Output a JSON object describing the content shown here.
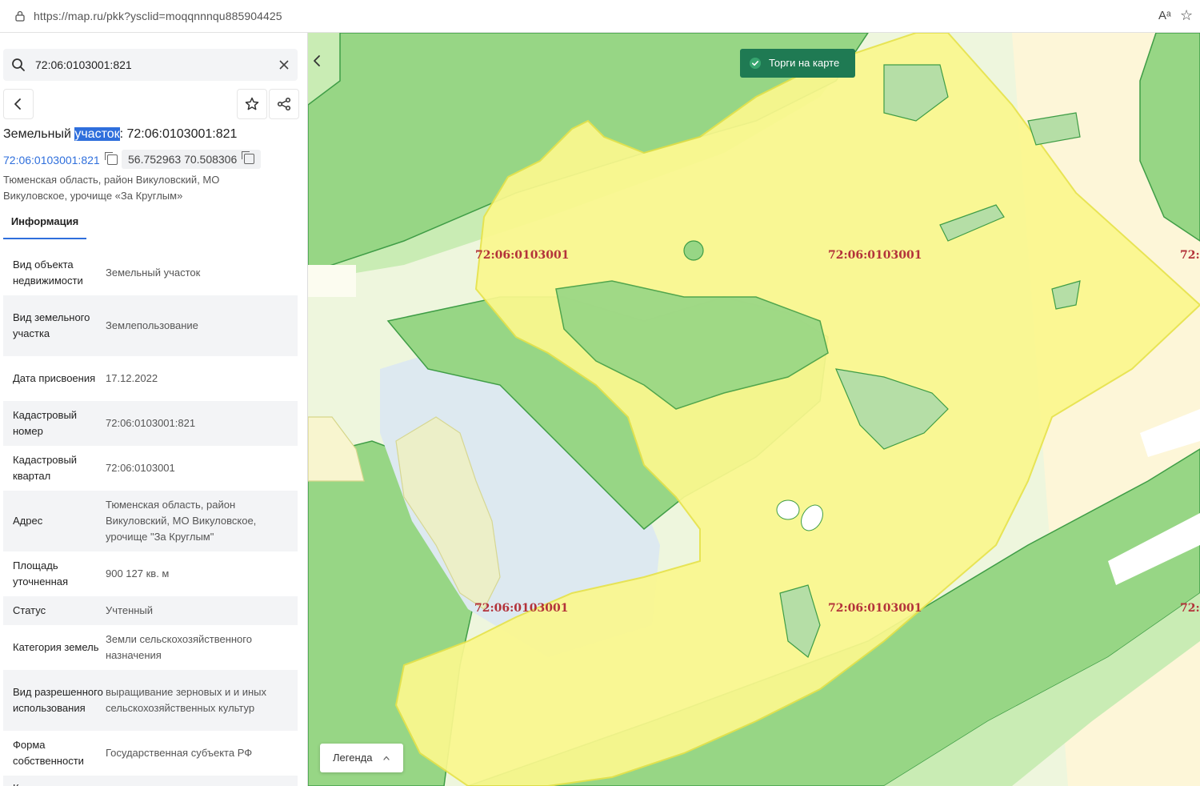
{
  "browser": {
    "url": "https://map.ru/pkk?ysclid=moqqnnnqu885904425",
    "read_mode_glyph": "Aᵃ",
    "favorite_glyph": "☆"
  },
  "search": {
    "value": "72:06:0103001:821"
  },
  "parcel": {
    "title_prefix": "Земельный ",
    "title_highlight": "участок",
    "title_suffix": ": 72:06:0103001:821",
    "cadastral_link": "72:06:0103001:821",
    "coordinates": "56.752963 70.508306",
    "address": "Тюменская область, район Викуловский, МО Викуловское, урочище «За Круглым»"
  },
  "tabs": {
    "info": "Информация"
  },
  "properties": [
    {
      "key": "Вид объекта недвижимости",
      "value": "Земельный участок"
    },
    {
      "key": "Вид земельного участка",
      "value": "Землепользование"
    },
    {
      "key": "Дата присвоения",
      "value": "17.12.2022"
    },
    {
      "key": "Кадастровый номер",
      "value": "72:06:0103001:821"
    },
    {
      "key": "Кадастровый квартал",
      "value": "72:06:0103001"
    },
    {
      "key": "Адрес",
      "value": "Тюменская область, район Викуловский, МО Викуловское, урочище \"За Круглым\""
    },
    {
      "key": "Площадь уточненная",
      "value": "900 127 кв. м"
    },
    {
      "key": "Статус",
      "value": "Учтенный"
    },
    {
      "key": "Категория земель",
      "value": "Земли сельскохозяйственного назначения"
    },
    {
      "key": "Вид разрешенного использования",
      "value": "выращивание зерновых и и иных сельскохозяйственных культур"
    },
    {
      "key": "Форма собственности",
      "value": "Государственная субъекта РФ"
    },
    {
      "key": "Кадастровая",
      "value": ""
    }
  ],
  "map": {
    "torgi_label": "Торги на карте",
    "legend_label": "Легенда",
    "quarter_labels": [
      "72:06:0103001",
      "72:06:0103001",
      "72:",
      "72:06:0103001",
      "72:06:0103001",
      "72:"
    ],
    "colors": {
      "forest": "#97d685",
      "forest_edge": "#3f9d46",
      "light_green": "#c9ecb4",
      "parcel_yellow": "#fbf88e",
      "water": "#dde9f0",
      "accent": "#1f7a53"
    }
  }
}
